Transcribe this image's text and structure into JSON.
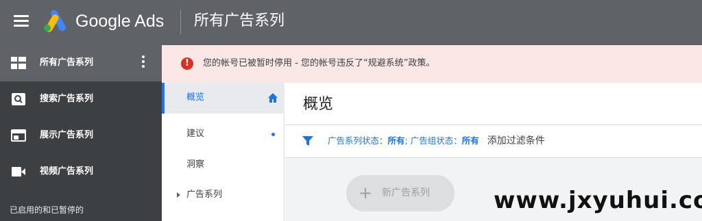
{
  "topbar": {
    "brand": "Google Ads",
    "page_title": "所有广告系列",
    "brand_colors": {
      "blue": "#4285f4",
      "yellow": "#fbbc04",
      "green": "#34a853"
    }
  },
  "leftnav": {
    "items": [
      {
        "label": "所有广告系列",
        "icon": "grid-icon",
        "active": true
      },
      {
        "label": "搜索广告系列",
        "icon": "search-icon",
        "active": false
      },
      {
        "label": "展示广告系列",
        "icon": "display-icon",
        "active": false
      },
      {
        "label": "视频广告系列",
        "icon": "video-icon",
        "active": false
      }
    ],
    "footer": "已启用的和已暂停的"
  },
  "banner": {
    "icon": "alert-icon",
    "text": "您的帐号已被暂时停用 - 您的帐号违反了“规避系统”政策。",
    "accent": "#d93025"
  },
  "subnav": {
    "items": [
      {
        "label": "概览",
        "active": true
      },
      {
        "label": "建议"
      },
      {
        "label": "洞察"
      },
      {
        "label": "广告系列"
      }
    ]
  },
  "main": {
    "title": "概览",
    "filter": {
      "campaign_status_key": "广告系列状态：",
      "campaign_status_val": "所有",
      "separator": "; ",
      "adgroup_status_key": "广告组状态：",
      "adgroup_status_val": "所有",
      "add_filter": "添加过滤条件"
    },
    "new_campaign_button": {
      "plus": "+",
      "label": "新广告系列"
    }
  },
  "watermark": "www.jxyuhui.com",
  "colors": {
    "accent": "#1a73e8",
    "topbar": "#5f6368",
    "nav_bg": "#3c4043"
  }
}
